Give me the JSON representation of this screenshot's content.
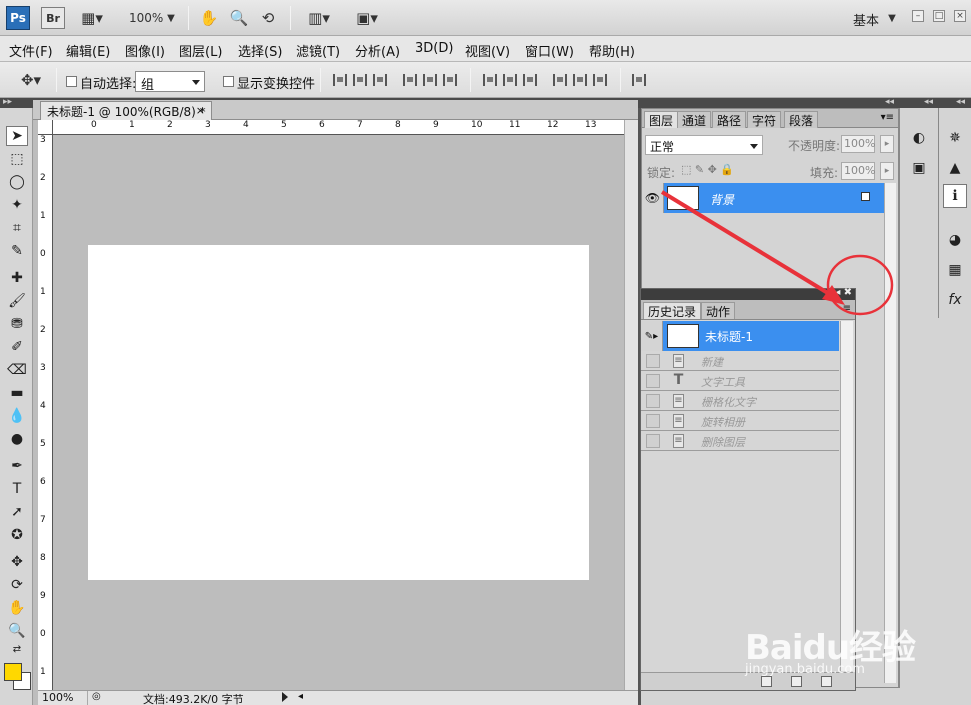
{
  "appbar": {
    "ps_logo": "Ps",
    "br_logo": "Br",
    "zoom": "100%",
    "workspace": "基本",
    "icons": [
      "screen-mode-icon",
      "zoom-dropdown-icon",
      "hand-icon",
      "zoom-icon",
      "rotate-view-icon",
      "arrange-docs-icon",
      "screen-mode-dropdown-icon"
    ]
  },
  "menu": {
    "items": [
      "文件(F)",
      "编辑(E)",
      "图像(I)",
      "图层(L)",
      "选择(S)",
      "滤镜(T)",
      "分析(A)",
      "3D(D)",
      "视图(V)",
      "窗口(W)",
      "帮助(H)"
    ]
  },
  "options": {
    "auto_select_label": "自动选择:",
    "auto_select_value": "组",
    "show_transform_label": "显示变换控件"
  },
  "document": {
    "tab_title": "未标题-1 @ 100%(RGB/8) *",
    "tab_close": "×",
    "ruler_h": [
      "0",
      "1",
      "2",
      "3",
      "4",
      "5",
      "6",
      "7",
      "8",
      "9",
      "10",
      "11",
      "12",
      "13"
    ],
    "ruler_v": [
      "3",
      "2",
      "1",
      "0",
      "1",
      "2",
      "3",
      "4",
      "5",
      "6",
      "7",
      "8",
      "9",
      "0",
      "1"
    ],
    "status_zoom": "100%",
    "status_info": "文档:493.2K/0 字节"
  },
  "layers_panel": {
    "tabs": [
      "图层",
      "通道",
      "路径",
      "字符",
      "段落"
    ],
    "blend_mode": "正常",
    "opacity_label": "不透明度:",
    "opacity_value": "100%",
    "lock_label": "锁定:",
    "fill_label": "填充:",
    "fill_value": "100%",
    "layer_name": "背景"
  },
  "history_panel": {
    "tabs": [
      "历史记录",
      "动作"
    ],
    "snapshot_name": "未标题-1",
    "states": [
      "新建",
      "文字工具",
      "栅格化文字",
      "旋转相册",
      "删除图层"
    ]
  },
  "colors": {
    "foreground": "#ffd800",
    "background": "#ffffff",
    "selection": "#3b8fef",
    "annotation": "#e8323a"
  },
  "watermark": {
    "main": "Baidu经验",
    "sub": "jingyan.baidu.com"
  }
}
